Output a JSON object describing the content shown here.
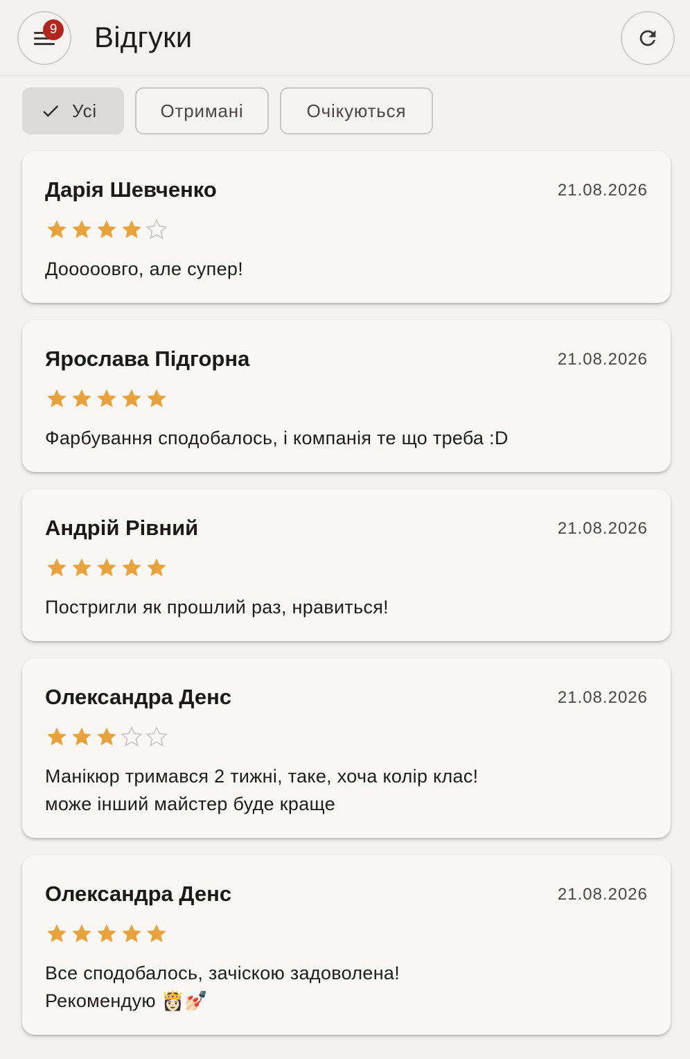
{
  "header": {
    "title": "Відгуки",
    "menu_badge": "9",
    "menu_icon": "menu-icon",
    "refresh_icon": "refresh-icon"
  },
  "filters": {
    "all": "Усі",
    "received": "Отримані",
    "pending": "Очікуються",
    "selected": "all"
  },
  "colors": {
    "star_filled": "#e8a23c",
    "star_empty": "#c9c5c1",
    "badge": "#b3261e",
    "background": "#f3f1ef",
    "card": "#f9f7f6"
  },
  "reviews": [
    {
      "name": "Дарія Шевченко",
      "date": "21.08.2026",
      "rating": 4,
      "text": "Дооооовго, але супер!"
    },
    {
      "name": "Ярослава Підгорна",
      "date": "21.08.2026",
      "rating": 5,
      "text": "Фарбування сподобалось, і компанія те що треба :D"
    },
    {
      "name": "Андрій Рівний",
      "date": "21.08.2026",
      "rating": 5,
      "text": "Постригли як прошлий раз, нравиться!"
    },
    {
      "name": "Олександра Денс",
      "date": "21.08.2026",
      "rating": 3,
      "text": "Манікюр тримався 2 тижні, таке, хоча колір клас!\nможе інший майстер буде краще"
    },
    {
      "name": "Олександра Денс",
      "date": "21.08.2026",
      "rating": 5,
      "text": "Все сподобалось, зачіскою задоволена!\nРекомендую 👸🏻💅🏻"
    }
  ]
}
